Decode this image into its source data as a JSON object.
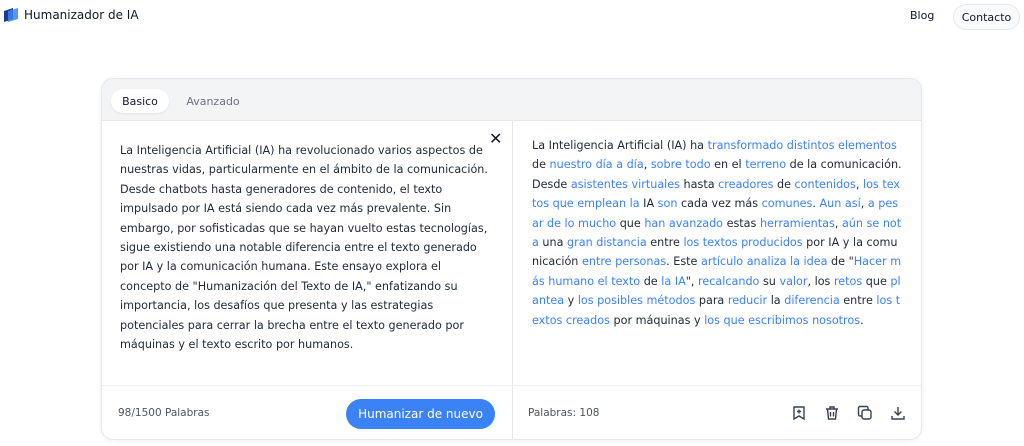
{
  "header": {
    "app_name": "Humanizador de IA",
    "nav_blog": "Blog",
    "nav_contact": "Contacto"
  },
  "tabs": {
    "basic": "Basico",
    "advanced": "Avanzado"
  },
  "input": {
    "text": "La Inteligencia Artificial (IA) ha revolucionado varios aspectos de nuestras vidas, particularmente en el ámbito de la comunicación. Desde chatbots hasta generadores de contenido, el texto impulsado por IA está siendo cada vez más prevalente. Sin embargo, por sofisticadas que se hayan vuelto estas tecnologías, sigue existiendo una notable diferencia entre el texto generado por IA y la comunicación humana. Este ensayo explora el concepto de \"Humanización del Texto de IA,\" enfatizando su importancia, los desafíos que presenta y las estrategias potenciales para cerrar la brecha entre el texto generado por máquinas y el texto escrito por humanos.",
    "word_count": "98/1500 Palabras",
    "close_glyph": "✕"
  },
  "actions": {
    "humanize_again": "Humanizar de nuevo"
  },
  "output": {
    "segments": [
      {
        "t": "La Inteligencia Artificial (IA) ha ",
        "h": false
      },
      {
        "t": "transformado distintos elementos",
        "h": true
      },
      {
        "t": " de ",
        "h": false
      },
      {
        "t": "nuestro día a día",
        "h": true
      },
      {
        "t": ", ",
        "h": false
      },
      {
        "t": "sobre todo",
        "h": true
      },
      {
        "t": " en el ",
        "h": false
      },
      {
        "t": "terreno",
        "h": true
      },
      {
        "t": " de la comunicación. Desde ",
        "h": false
      },
      {
        "t": "asistentes virtuales",
        "h": true
      },
      {
        "t": " hasta ",
        "h": false
      },
      {
        "t": "creadores",
        "h": true
      },
      {
        "t": " de ",
        "h": false
      },
      {
        "t": "contenidos",
        "h": true
      },
      {
        "t": ", ",
        "h": false
      },
      {
        "t": "los textos que emplean la",
        "h": true
      },
      {
        "t": " IA ",
        "h": false
      },
      {
        "t": "son",
        "h": true
      },
      {
        "t": " cada vez más ",
        "h": false
      },
      {
        "t": "comunes",
        "h": true
      },
      {
        "t": ". ",
        "h": false
      },
      {
        "t": "Aun así",
        "h": true
      },
      {
        "t": ", ",
        "h": false
      },
      {
        "t": "a pesar de lo mucho",
        "h": true
      },
      {
        "t": " que ",
        "h": false
      },
      {
        "t": "han avanzado",
        "h": true
      },
      {
        "t": " estas ",
        "h": false
      },
      {
        "t": "herramientas",
        "h": true
      },
      {
        "t": ", ",
        "h": false
      },
      {
        "t": "aún se nota",
        "h": true
      },
      {
        "t": " una ",
        "h": false
      },
      {
        "t": "gran distancia",
        "h": true
      },
      {
        "t": " entre ",
        "h": false
      },
      {
        "t": "los textos producidos",
        "h": true
      },
      {
        "t": " por IA y la comunicación ",
        "h": false
      },
      {
        "t": "entre personas",
        "h": true
      },
      {
        "t": ". Este ",
        "h": false
      },
      {
        "t": "artículo analiza la idea",
        "h": true
      },
      {
        "t": " de \"",
        "h": false
      },
      {
        "t": "Hacer más humano el texto",
        "h": true
      },
      {
        "t": " de ",
        "h": false
      },
      {
        "t": "la IA",
        "h": true
      },
      {
        "t": "\", ",
        "h": false
      },
      {
        "t": "recalcando",
        "h": true
      },
      {
        "t": " su ",
        "h": false
      },
      {
        "t": "valor",
        "h": true
      },
      {
        "t": ", los ",
        "h": false
      },
      {
        "t": "retos",
        "h": true
      },
      {
        "t": " que ",
        "h": false
      },
      {
        "t": "plantea",
        "h": true
      },
      {
        "t": " y ",
        "h": false
      },
      {
        "t": "los posibles métodos",
        "h": true
      },
      {
        "t": " para ",
        "h": false
      },
      {
        "t": "reducir",
        "h": true
      },
      {
        "t": " la ",
        "h": false
      },
      {
        "t": "diferencia",
        "h": true
      },
      {
        "t": " entre ",
        "h": false
      },
      {
        "t": "los textos creados",
        "h": true
      },
      {
        "t": " por máquinas y ",
        "h": false
      },
      {
        "t": "los que escribimos nosotros",
        "h": true
      },
      {
        "t": ".",
        "h": false
      }
    ],
    "word_count": "Palabras: 108"
  },
  "icons": {
    "brand": "brand-logo-icon",
    "save": "save-icon",
    "delete": "trash-icon",
    "copy": "copy-icon",
    "download": "download-icon"
  },
  "colors": {
    "accent": "#3b82f6",
    "tab_bar": "#f3f4f6"
  }
}
